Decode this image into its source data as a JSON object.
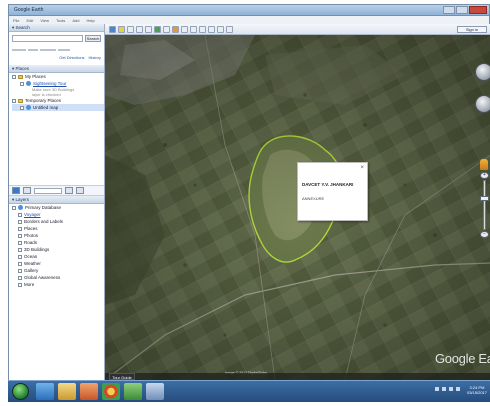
{
  "window": {
    "title": "Google Earth",
    "menu": [
      "File",
      "Edit",
      "View",
      "Tools",
      "Add",
      "Help"
    ]
  },
  "sidebar": {
    "search_header": "▾ Search",
    "search_button": "Search",
    "links": [
      "Get Directions",
      "History"
    ],
    "places_header": "▾ Places",
    "places": [
      {
        "label": "My Places",
        "kind": "folder"
      },
      {
        "label": "Sightseeing Tour",
        "kind": "link"
      },
      {
        "label": "Make sure 3D Buildings",
        "kind": "sub"
      },
      {
        "label": "layer is checked",
        "kind": "sub"
      },
      {
        "label": "Temporary Places",
        "kind": "folder"
      },
      {
        "label": "Untitled map",
        "kind": "item"
      }
    ],
    "layers_header": "▾ Layers",
    "layers": [
      "Primary Database",
      "Voyager",
      "Borders and Labels",
      "Places",
      "Photos",
      "Roads",
      "3D Buildings",
      "Ocean",
      "Weather",
      "Gallery",
      "Global Awareness",
      "More"
    ]
  },
  "toolbar": {
    "sign_in": "Sign in"
  },
  "map": {
    "info_title": "DAVCET Y.V. JHANKARI",
    "info_text": "ANNEXURE",
    "close": "×",
    "watermark": "Google Earth",
    "tour_button": "Tour Guide",
    "attribution": "Image © 2017 DigitalGlobe"
  },
  "taskbar": {
    "clock_time": "3:24 PM",
    "clock_date": "03/15/2017"
  }
}
